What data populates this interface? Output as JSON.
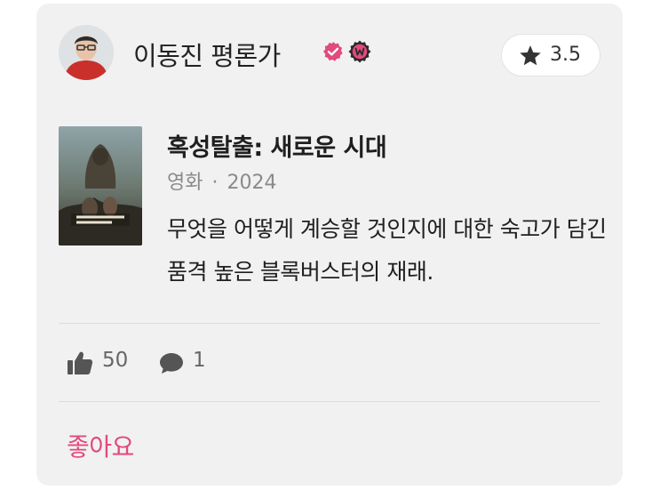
{
  "review": {
    "author": "이동진 평론가",
    "rating": "3.5",
    "movie_title": "혹성탈출: 새로운 시대",
    "category": "영화",
    "separator": "·",
    "year": "2024",
    "text": "무엇을 어떻게 계승할 것인지에 대한 숙고가 담긴 품격 높은 블록버스터의 재래.",
    "likes": "50",
    "comments": "1",
    "like_button_label": "좋아요"
  },
  "colors": {
    "accent": "#e2497c",
    "card_bg": "#f1f1f2"
  },
  "icons": {
    "verified": "verified-badge-icon",
    "watcha": "watcha-badge-icon",
    "star": "star-icon",
    "like": "thumbs-up-icon",
    "comment": "comment-bubble-icon"
  }
}
